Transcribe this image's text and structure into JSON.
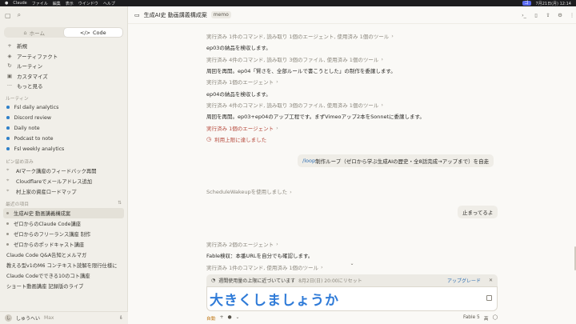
{
  "menubar": {
    "app": "Claude",
    "items": [
      "ファイル",
      "編集",
      "表示",
      "ウインドウ",
      "ヘルプ"
    ],
    "pill": "ゴ",
    "datetime": "7月21日(月) 12:14"
  },
  "sidebar": {
    "tabs": [
      {
        "label": "ホーム",
        "icon": "home-icon"
      },
      {
        "label": "Code",
        "icon": "code-icon"
      }
    ],
    "nav": [
      {
        "label": "新規",
        "icon": "plus-icon"
      },
      {
        "label": "アーティファクト",
        "icon": "artifact-icon"
      },
      {
        "label": "ルーティン",
        "icon": "routine-icon"
      },
      {
        "label": "カスタマイズ",
        "icon": "customize-icon"
      },
      {
        "label": "もっと見る",
        "icon": "more-icon"
      }
    ],
    "routines_title": "ルーティン",
    "routines": [
      "Fsl daily analytics",
      "Discord review",
      "Daily note",
      "Podcast to note",
      "Fsl weekly analytics"
    ],
    "pinned_title": "ピン留め済み",
    "pinned": [
      "AIマーク講座のフィードバック再開",
      "Cloudflareでメールアドレス追加",
      "村上家の資産ロードマップ"
    ],
    "recent_title": "最近の項目",
    "recent": [
      "生成AI史 動画講義構成案",
      "ゼロからのClaude Code講座",
      "ゼロからのフリーランス講座 制作",
      "ゼロからのポッドキャスト講座",
      "Claude Code Q&A告知とメルマガ",
      "教える型v1のM6 コンテキスト読解を限行仕様に",
      "Claude Codeでできる10のコト講座",
      "ショート動画講座 記録版のライブ"
    ],
    "user": {
      "initial": "し",
      "name": "しゅうへい",
      "plan": "Max"
    }
  },
  "header": {
    "title": "生成AI史 動画講義構成案",
    "badge": "memo"
  },
  "conversation": [
    {
      "kind": "meta",
      "text": "実行済み 1件のコマンド, 読み取り 1個のエージェント, 使用済み 1個のツール"
    },
    {
      "kind": "text",
      "text": "ep03の納品を検収します。"
    },
    {
      "kind": "meta",
      "text": "実行済み 4件のコマンド, 読み取り 3個のファイル, 使用済み 1個のツール"
    },
    {
      "kind": "text",
      "text": "周回を再開。ep04「賢さを、全部ルールで書こうとした」の制作を委譲します。"
    },
    {
      "kind": "meta",
      "text": "実行済み 1個のエージェント"
    },
    {
      "kind": "text",
      "text": "ep04の納品を検収します。"
    },
    {
      "kind": "meta",
      "text": "実行済み 4件のコマンド, 読み取り 3個のファイル, 使用済み 1個のツール"
    },
    {
      "kind": "text",
      "text": "周回を再開。ep03+ep04のアップ工程です。まずVimeoアップ2本をSonnetに委譲します。"
    },
    {
      "kind": "meta-red",
      "text": "実行済み 1個のエージェント"
    }
  ],
  "limit_notice": "利用上限に達しました",
  "user_message": {
    "command": "/loop",
    "text": " 制作ループ（ゼロから学ぶ生成AIの歴史・全8話完成→アップまで）を自走"
  },
  "schedule_line": "ScheduleWakeupを使用しました",
  "user_message2": "止まってるよ",
  "conversation2": [
    {
      "kind": "meta",
      "text": "実行済み 2個のエージェント"
    },
    {
      "kind": "text",
      "text": "Fable検収：本番URLを自分でも確認します。"
    },
    {
      "kind": "meta",
      "text": "実行済み 1件のコマンド, 使用済み 1個のツール"
    }
  ],
  "banner": {
    "text": "週間使用量の上限に近づいています",
    "reset": "8月2日(日) 20:00にリセット",
    "upgrade": "アップグレード"
  },
  "composer": {
    "value": "大きくしましょうか"
  },
  "composer_bar": {
    "mode": "自動",
    "model": "Fable 5",
    "effort": "高"
  }
}
